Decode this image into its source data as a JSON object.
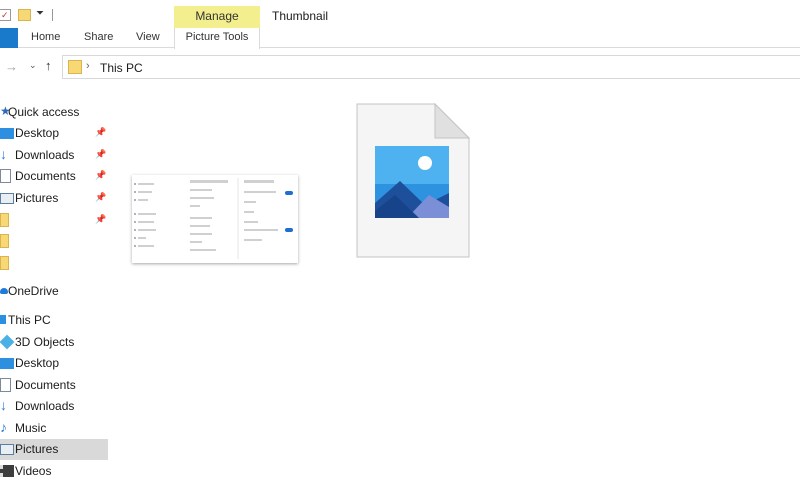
{
  "window": {
    "title": "Thumbnail",
    "contextual_header": "Manage"
  },
  "ribbon": {
    "tabs": [
      {
        "label": "Home"
      },
      {
        "label": "Share"
      },
      {
        "label": "View"
      },
      {
        "label": "Picture Tools"
      }
    ]
  },
  "address": {
    "path": "This PC"
  },
  "nav": {
    "quick_access": "Quick access",
    "quick_items": [
      {
        "label": "Desktop",
        "icon": "desktop-icon",
        "pinned": true
      },
      {
        "label": "Downloads",
        "icon": "downloads-icon",
        "pinned": true
      },
      {
        "label": "Documents",
        "icon": "documents-icon",
        "pinned": true
      },
      {
        "label": "Pictures",
        "icon": "pictures-icon",
        "pinned": true
      },
      {
        "label": "",
        "icon": "folder-icon",
        "pinned": true
      },
      {
        "label": "",
        "icon": "folder-icon",
        "pinned": false
      },
      {
        "label": "",
        "icon": "folder-icon",
        "pinned": false
      }
    ],
    "onedrive": "OneDrive",
    "this_pc": "This PC",
    "pc_items": [
      {
        "label": "3D Objects",
        "icon": "3d-objects-icon"
      },
      {
        "label": "Desktop",
        "icon": "desktop-icon"
      },
      {
        "label": "Documents",
        "icon": "documents-icon"
      },
      {
        "label": "Downloads",
        "icon": "downloads-icon"
      },
      {
        "label": "Music",
        "icon": "music-icon"
      },
      {
        "label": "Pictures",
        "icon": "pictures-icon",
        "selected": true
      },
      {
        "label": "Videos",
        "icon": "videos-icon"
      }
    ]
  },
  "colors": {
    "accent": "#1979ca",
    "manage_tab": "#f3ef8e",
    "folder": "#f8d775",
    "selection": "#d9d9d9"
  }
}
